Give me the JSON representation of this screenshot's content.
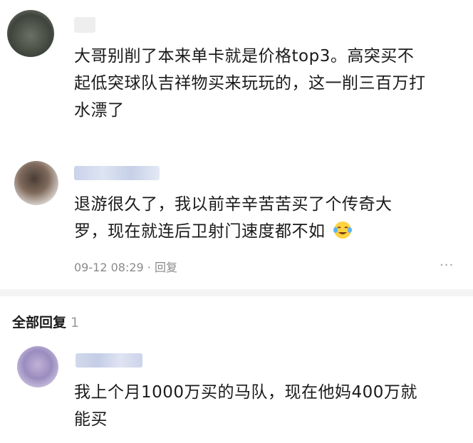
{
  "comments": [
    {
      "text": "大哥别削了本来单卡就是价格top3。高突买不起低突球队吉祥物买来玩玩的，这一削三百万打水漂了"
    },
    {
      "text": "退游很久了，我以前辛辛苦苦买了个传奇大罗，现在就连后卫射门速度都不如",
      "emoji": "crying-laughing-emoji",
      "timestamp": "09-12 08:29",
      "separator": "·",
      "reply_label": "回复",
      "more_label": "···"
    }
  ],
  "all_replies": {
    "title": "全部回复",
    "count": "1"
  },
  "replies": [
    {
      "text": "我上个月1000万买的马队，现在他妈400万就能买"
    }
  ],
  "colors": {
    "text": "#1a1a1a",
    "meta": "#8a8a8a",
    "divider": "#f4f4f4"
  }
}
